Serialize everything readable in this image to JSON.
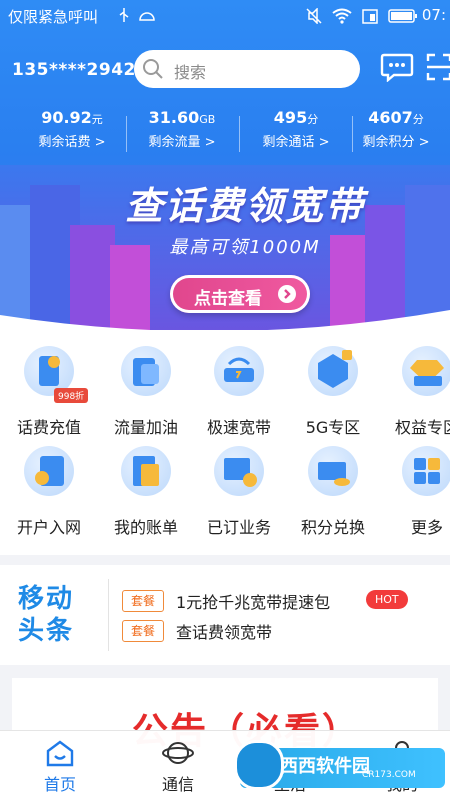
{
  "status_bar": {
    "carrier": "仅限紧急呼叫",
    "time": "07:"
  },
  "header": {
    "phone": "135****2942",
    "search_placeholder": "搜索"
  },
  "stats": [
    {
      "value": "90.92",
      "unit": "元",
      "label": "剩余话费 >"
    },
    {
      "value": "31.60",
      "unit": "GB",
      "label": "剩余流量 >"
    },
    {
      "value": "495",
      "unit": "分",
      "label": "剩余通话 >"
    },
    {
      "value": "4607",
      "unit": "分",
      "label": "剩余积分 >"
    }
  ],
  "banner": {
    "title": "查话费领宽带",
    "subtitle": "最高可领1000M",
    "button": "点击查看"
  },
  "grid": [
    {
      "label": "话费充值",
      "icon": "phone-recharge-icon",
      "badge": "998折"
    },
    {
      "label": "流量加油",
      "icon": "data-boost-icon"
    },
    {
      "label": "极速宽带",
      "icon": "broadband-icon"
    },
    {
      "label": "5G专区",
      "icon": "5g-icon"
    },
    {
      "label": "权益专区",
      "icon": "diamond-icon"
    },
    {
      "label": "开户入网",
      "icon": "sim-card-icon"
    },
    {
      "label": "我的账单",
      "icon": "bill-icon"
    },
    {
      "label": "已订业务",
      "icon": "subscribed-icon"
    },
    {
      "label": "积分兑换",
      "icon": "points-icon"
    },
    {
      "label": "更多",
      "icon": "more-icon"
    }
  ],
  "news": {
    "logo_line1": "移动",
    "logo_line2": "头条",
    "items": [
      {
        "tag": "套餐",
        "text": "1元抢千兆宽带提速包",
        "badge": "HOT"
      },
      {
        "tag": "套餐",
        "text": "查话费领宽带"
      }
    ]
  },
  "notice": {
    "title": "公告（必看）"
  },
  "tabs": [
    {
      "label": "首页",
      "icon": "home-icon",
      "active": true
    },
    {
      "label": "通信",
      "icon": "planet-icon"
    },
    {
      "label": "生活",
      "icon": "coffee-icon"
    },
    {
      "label": "我的",
      "icon": "user-icon"
    }
  ],
  "watermark": {
    "text": "西西软件园",
    "sub": "CR173.COM"
  },
  "colors": {
    "primary": "#2a7ff0",
    "accent": "#e0468d",
    "hot": "#f23b3b",
    "tag": "#f06a1a"
  }
}
